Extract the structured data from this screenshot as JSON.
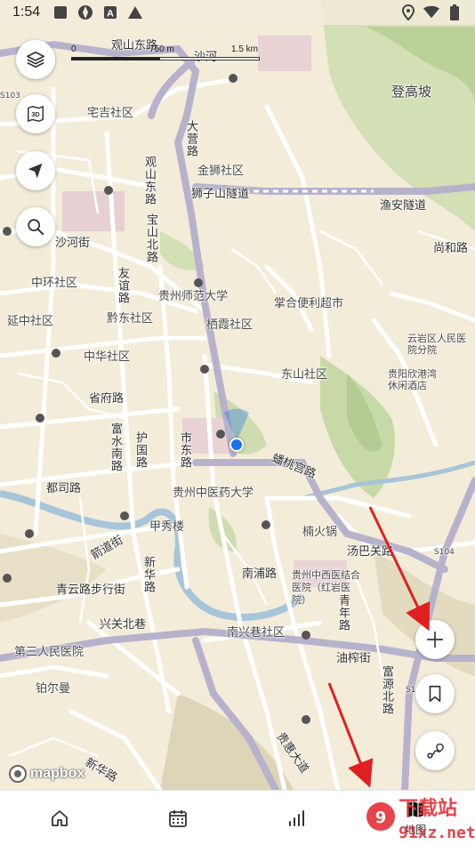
{
  "status_bar": {
    "time": "1:54",
    "icons": [
      "notification-square-icon",
      "shutter-icon",
      "a-icon",
      "triangle-icon"
    ],
    "right_icons": [
      "location-icon",
      "wifi-icon",
      "battery-icon"
    ]
  },
  "scale": {
    "zero": "0",
    "mid": "750 m",
    "end": "1.5 km"
  },
  "map": {
    "places": [
      {
        "text": "宅吉社区"
      },
      {
        "text": "登高坡"
      },
      {
        "text": "金狮社区"
      },
      {
        "text": "狮子山隧道"
      },
      {
        "text": "渔安隧道"
      },
      {
        "text": "尚和路"
      },
      {
        "text": "沙河街"
      },
      {
        "text": "中环社区"
      },
      {
        "text": "贵州师范大学"
      },
      {
        "text": "掌合便利超市"
      },
      {
        "text": "延中社区"
      },
      {
        "text": "黔东社区"
      },
      {
        "text": "栖霞社区"
      },
      {
        "text": "云岩区人民医院分院"
      },
      {
        "text": "中华社区"
      },
      {
        "text": "东山社区"
      },
      {
        "text": "省府路"
      },
      {
        "text": "贵阳欣港湾休闲酒店"
      },
      {
        "text": "蟠桃宫路"
      },
      {
        "text": "都司路"
      },
      {
        "text": "贵州中医药大学"
      },
      {
        "text": "甲秀楼"
      },
      {
        "text": "楠火锅"
      },
      {
        "text": "汤巴关路"
      },
      {
        "text": "南浦路"
      },
      {
        "text": "贵州中西医结合医院（红岩医院）"
      },
      {
        "text": "青云路步行街"
      },
      {
        "text": "兴关北巷"
      },
      {
        "text": "南兴巷社区"
      },
      {
        "text": "第三人民医院"
      },
      {
        "text": "油榨街"
      },
      {
        "text": "铂尔曼"
      },
      {
        "text": "观山东路"
      },
      {
        "text": "沙河"
      },
      {
        "text": "大营路"
      },
      {
        "text": "观山东路"
      },
      {
        "text": "宝山北路"
      },
      {
        "text": "友谊路"
      },
      {
        "text": "富水南路"
      },
      {
        "text": "护国路"
      },
      {
        "text": "市东路"
      },
      {
        "text": "新华路"
      },
      {
        "text": "箭道街"
      },
      {
        "text": "青年路"
      },
      {
        "text": "富源北路"
      },
      {
        "text": "新华路"
      },
      {
        "text": "贵惠大道"
      },
      {
        "text": "S103"
      },
      {
        "text": "S104"
      },
      {
        "text": "S1"
      }
    ]
  },
  "mapbox": {
    "label": "mapbox"
  },
  "bottom_nav": {
    "items": [
      {
        "icon": "home-icon",
        "label": ""
      },
      {
        "icon": "calendar-icon",
        "label": ""
      },
      {
        "icon": "stats-icon",
        "label": ""
      },
      {
        "icon": "map-icon",
        "label": "地图"
      }
    ]
  },
  "watermark": {
    "brand": "下载站",
    "site": "91xz.net"
  },
  "colors": {
    "accent": "#1a73e8",
    "arrow": "#e02020",
    "map_bg": "#f3ecd9",
    "road": "#ffffff",
    "highway": "#b7b2cc"
  }
}
